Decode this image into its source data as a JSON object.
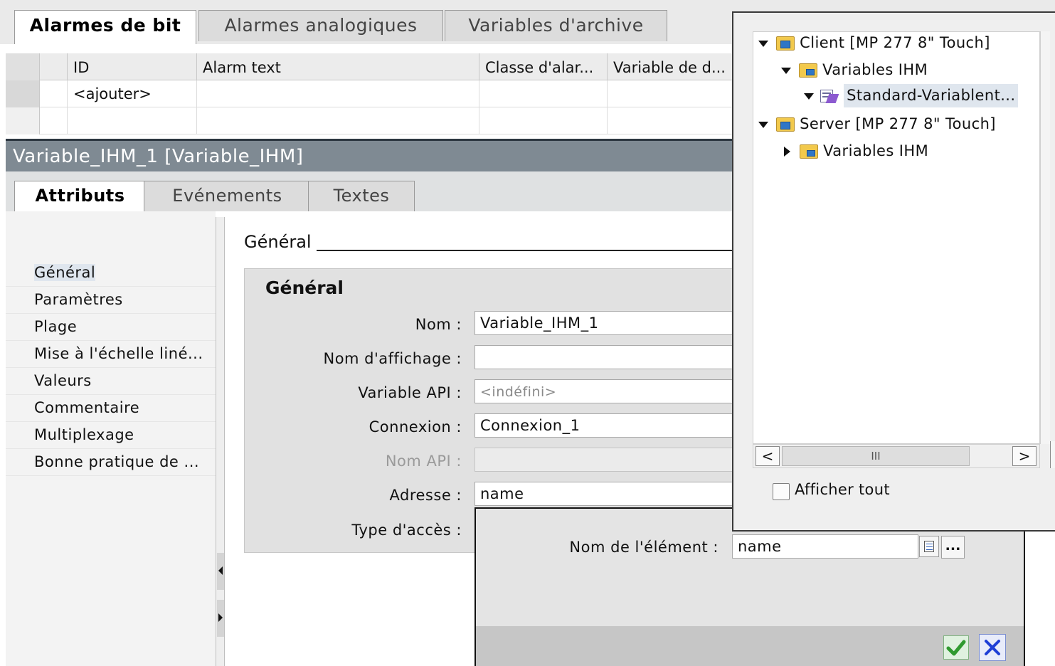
{
  "top_tabs": [
    "Alarmes de bit",
    "Alarmes analogiques",
    "Variables d'archive"
  ],
  "alarm_table": {
    "columns": [
      "ID",
      "Alarm text",
      "Classe d'alar...",
      "Variable de d..."
    ],
    "add_row": "<ajouter>"
  },
  "panel": {
    "title": "Variable_IHM_1 [Variable_IHM]",
    "tabs": [
      "Attributs",
      "Evénements",
      "Textes"
    ],
    "nav_items": [
      "Général",
      "Paramètres",
      "Plage",
      "Mise à l'échelle liné...",
      "Valeurs",
      "Commentaire",
      "Multiplexage",
      "Bonne pratique de ..."
    ],
    "section_heading": "Général",
    "section_title": "Général"
  },
  "form": {
    "nom_label": "Nom :",
    "nom_value": "Variable_IHM_1",
    "nom_affichage_label": "Nom d'affichage :",
    "nom_affichage_value": "",
    "variable_api_label": "Variable API :",
    "variable_api_value": "<indéfini>",
    "connexion_label": "Connexion :",
    "connexion_value": "Connexion_1",
    "nom_api_label": "Nom API :",
    "nom_api_value": "",
    "adresse_label": "Adresse :",
    "adresse_value": "name",
    "type_acces_label": "Type d'accès :"
  },
  "address_popup": {
    "element_label": "Nom de l'élément :",
    "element_value": "name",
    "browse_label": "...",
    "ok_icon": "check-icon",
    "cancel_icon": "x-icon"
  },
  "tree": {
    "nodes": [
      {
        "label": "Client [MP 277 8\" Touch]",
        "expanded": true,
        "icon": "device-folder-icon"
      },
      {
        "label": "Variables IHM",
        "expanded": true,
        "icon": "tag-folder-icon"
      },
      {
        "label": "Standard-Variablent...",
        "expanded": true,
        "selected": true,
        "icon": "tag-table-icon"
      },
      {
        "label": "Server [MP 277 8\" Touch]",
        "expanded": true,
        "icon": "device-folder-icon"
      },
      {
        "label": "Variables IHM",
        "expanded": false,
        "icon": "tag-folder-icon"
      }
    ],
    "scroll_label": "III",
    "show_all_label": "Afficher tout",
    "show_all_checked": false
  },
  "colors": {
    "panel_title_bg": "#7f8a93",
    "selection_bg": "#dfe6ee",
    "ok_green": "#3aa13a",
    "cancel_blue": "#1f3fd6"
  }
}
